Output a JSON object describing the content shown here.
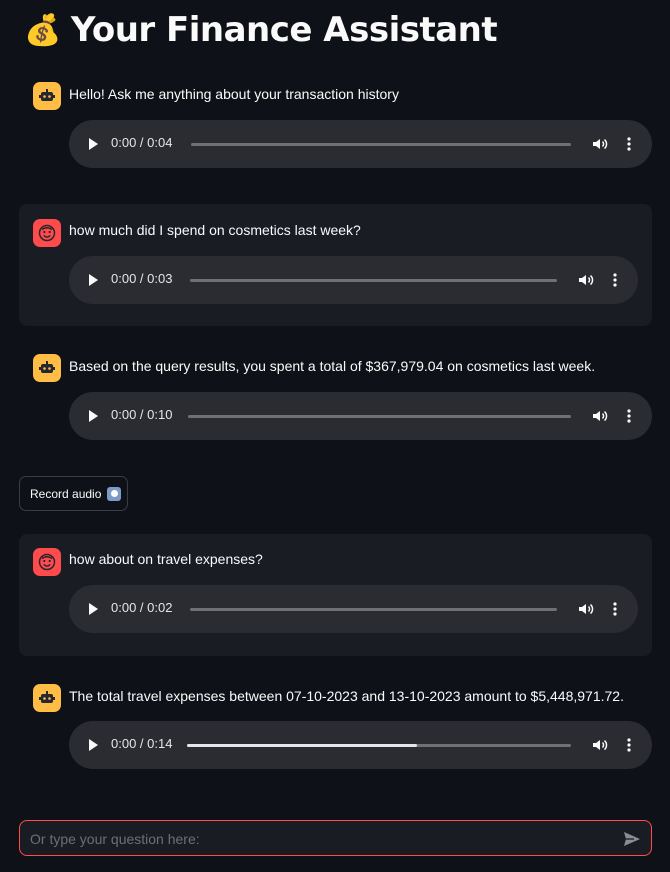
{
  "header": {
    "icon": "money-bag-icon",
    "title": "Your Finance Assistant"
  },
  "messages": [
    {
      "role": "assistant",
      "text": "Hello! Ask me anything about your transaction history",
      "audio": {
        "time": "0:00 / 0:04",
        "progress": 0
      }
    },
    {
      "role": "user",
      "text": "how much did I spend on cosmetics last week?",
      "audio": {
        "time": "0:00 / 0:03",
        "progress": 0
      }
    },
    {
      "role": "assistant",
      "text": "Based on the query results, you spent a total of $367,979.04 on cosmetics last week.",
      "audio": {
        "time": "0:00 / 0:10",
        "progress": 0
      }
    },
    {
      "role": "user",
      "text": "how about on travel expenses?",
      "audio": {
        "time": "0:00 / 0:02",
        "progress": 0
      }
    },
    {
      "role": "assistant",
      "text": "The total travel expenses between 07-10-2023 and 13-10-2023 amount to $5,448,971.72.",
      "audio": {
        "time": "0:00 / 0:14",
        "progress": 0.6
      }
    }
  ],
  "record_button": {
    "label": "Record audio",
    "icon": "record-icon"
  },
  "chat_input": {
    "placeholder": "Or type your question here:",
    "value": "",
    "send_icon": "send-icon"
  },
  "colors": {
    "background": "#0e1117",
    "assistant_avatar": "#ffbd45",
    "user_avatar": "#ff4b4b",
    "input_border": "#ff4b4b"
  }
}
